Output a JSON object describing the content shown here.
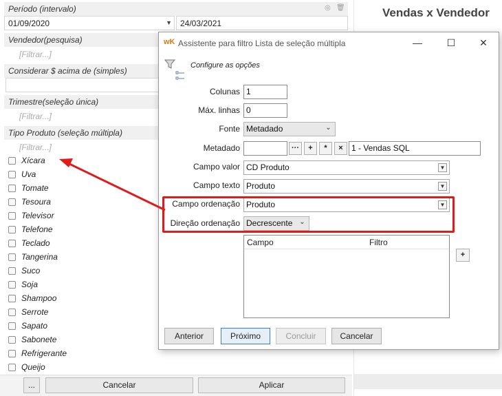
{
  "left_panel": {
    "periodo": {
      "title": "Período (intervalo)",
      "start_date": "01/09/2020",
      "end_date": "24/03/2021"
    },
    "vendedor": {
      "title": "Vendedor(pesquisa)",
      "placeholder": "[Filtrar...]"
    },
    "considerar": {
      "title": "Considerar $ acima de (simples)",
      "value": ""
    },
    "trimestre": {
      "title": "Trimestre(seleção única)",
      "placeholder": "[Filtrar...]"
    },
    "tipo_produto": {
      "title": "Tipo Produto (seleção múltipla)",
      "placeholder": "[Filtrar...]",
      "items": [
        "Xícara",
        "Uva",
        "Tomate",
        "Tesoura",
        "Televisor",
        "Telefone",
        "Teclado",
        "Tangerina",
        "Suco",
        "Soja",
        "Shampoo",
        "Serrote",
        "Sapato",
        "Sabonete",
        "Refrigerante",
        "Queijo"
      ]
    },
    "buttons": {
      "more": "...",
      "cancel": "Cancelar",
      "apply": "Aplicar"
    }
  },
  "right_panel": {
    "title": "Vendas x Vendedor"
  },
  "dialog": {
    "logo": "wK",
    "title": "Assistente para filtro Lista de seleção múltipla",
    "header": "Configure as opções",
    "fields": {
      "colunas_label": "Colunas",
      "colunas_value": "1",
      "max_linhas_label": "Máx. linhas",
      "max_linhas_value": "0",
      "fonte_label": "Fonte",
      "fonte_value": "Metadado",
      "metadado_label": "Metadado",
      "metadado_value": "",
      "metadado_name": "1 - Vendas SQL",
      "campo_valor_label": "Campo valor",
      "campo_valor_value": "CD Produto",
      "campo_texto_label": "Campo texto",
      "campo_texto_value": "Produto",
      "campo_ordenacao_label": "Campo ordenação",
      "campo_ordenacao_value": "Produto",
      "direcao_ordenacao_label": "Direção ordenação",
      "direcao_ordenacao_value": "Decrescente"
    },
    "grid": {
      "columns": [
        "Campo",
        "Filtro"
      ]
    },
    "buttons": {
      "previous": "Anterior",
      "next": "Próximo",
      "finish": "Concluir",
      "cancel": "Cancelar",
      "add": "+",
      "ellipsis": "···",
      "plus": "+",
      "star": "*",
      "clear": "×"
    },
    "window_controls": {
      "minimize": "—",
      "maximize": "☐",
      "close": "✕"
    }
  },
  "colors": {
    "highlight": "#e01b1b",
    "primary_border": "#3c7fd1",
    "logo": "#e07a10"
  }
}
